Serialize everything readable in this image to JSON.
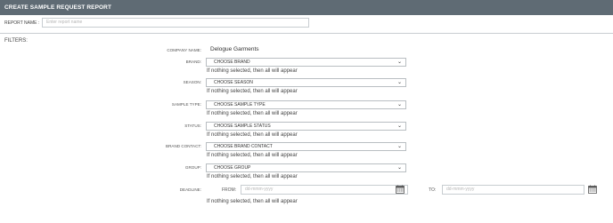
{
  "title": "CREATE SAMPLE REQUEST REPORT",
  "report_name": {
    "label": "REPORT NAME :",
    "placeholder": "Enter report name"
  },
  "filters_label": "FILTERS:",
  "company": {
    "label": "COMPANY NAME:",
    "value": "Delogue Garments"
  },
  "brand": {
    "label": "BRAND:",
    "selected": "CHOOSE BRAND",
    "hint": "If nothing selected, then all will appear"
  },
  "season": {
    "label": "SEASON:",
    "selected": "CHOOSE SEASON",
    "hint": "If nothing selected, then all will appear"
  },
  "sample_type": {
    "label": "SAMPLE TYPE:",
    "selected": "CHOOSE SAMPLE TYPE",
    "hint": "If nothing selected, then all will appear"
  },
  "status": {
    "label": "STATUS:",
    "selected": "CHOOSE SAMPLE STATUS",
    "hint": "If nothing selected, then all will appear"
  },
  "brand_contact": {
    "label": "BRAND CONTACT:",
    "selected": "CHOOSE BRAND CONTACT",
    "hint": "If nothing selected, then all will appear"
  },
  "group": {
    "label": "GROUP:",
    "selected": "CHOOSE GROUP",
    "hint": "If nothing selected, then all will appear"
  },
  "deadline": {
    "label": "DEADLINE:",
    "from_label": "FROM:",
    "from_placeholder": "dd-mmm-yyyy",
    "to_label": "TO:",
    "to_placeholder": "dd-mmm-yyyy",
    "hint": "If nothing selected, then all will appear"
  },
  "icons": {
    "dropdown": "chevron-down-icon",
    "calendar": "calendar-icon"
  },
  "colors": {
    "titlebar": "#5f6b74",
    "border": "#c8cdd1"
  }
}
